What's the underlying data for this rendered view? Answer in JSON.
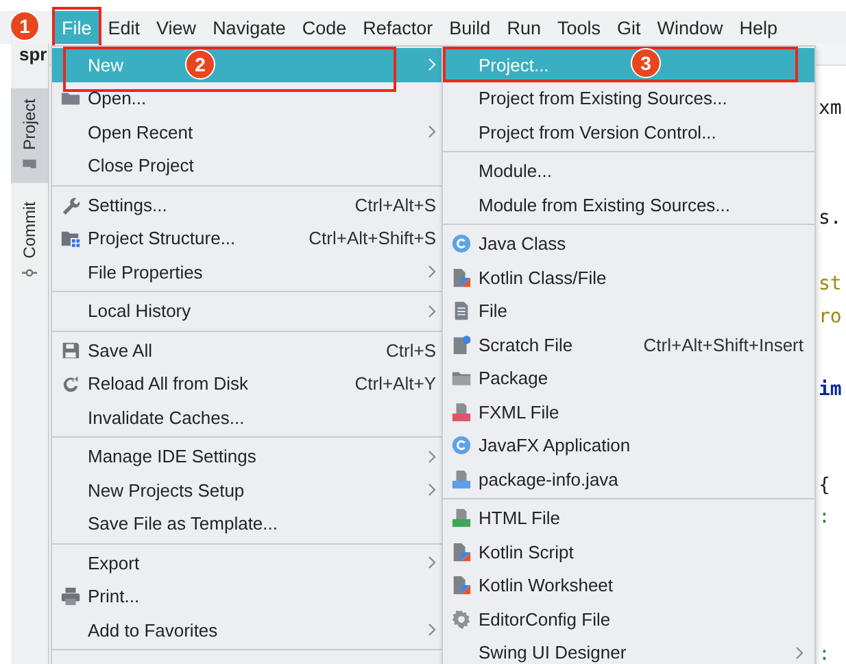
{
  "menubar": [
    {
      "label": "File",
      "selected": true,
      "callout": "1"
    },
    {
      "label": "Edit",
      "selected": false
    },
    {
      "label": "View",
      "selected": false
    },
    {
      "label": "Navigate",
      "selected": false
    },
    {
      "label": "Code",
      "selected": false
    },
    {
      "label": "Refactor",
      "selected": false
    },
    {
      "label": "Build",
      "selected": false
    },
    {
      "label": "Run",
      "selected": false
    },
    {
      "label": "Tools",
      "selected": false
    },
    {
      "label": "Git",
      "selected": false
    },
    {
      "label": "Window",
      "selected": false
    },
    {
      "label": "Help",
      "selected": false
    }
  ],
  "editor_tab": {
    "label": "spr"
  },
  "side_tabs": [
    {
      "label": "Project",
      "selected": true
    },
    {
      "label": "Commit",
      "selected": false
    }
  ],
  "code_lines": [
    {
      "text": "xm",
      "kind": "plain"
    },
    {
      "text": "s.",
      "kind": "plain"
    },
    {
      "text": "st",
      "kind": "string"
    },
    {
      "text": "ro",
      "kind": "string"
    },
    {
      "text": "im",
      "kind": "keyword"
    },
    {
      "text": "{",
      "kind": "plain"
    },
    {
      "text": ":",
      "kind": "annotation"
    },
    {
      "text": ":",
      "kind": "annotation"
    }
  ],
  "file_menu": {
    "items": [
      {
        "kind": "plain",
        "label": "New",
        "selected": true,
        "submenu": true,
        "callout": "2"
      },
      {
        "kind": "folder",
        "label": "Open...",
        "selected": false,
        "submenu": false
      },
      {
        "kind": "plain",
        "label": "Open Recent",
        "selected": false,
        "submenu": true
      },
      {
        "kind": "plain",
        "label": "Close Project",
        "selected": false,
        "submenu": false
      },
      {
        "kind": "separator"
      },
      {
        "kind": "wrench",
        "label": "Settings...",
        "shortcut": "Ctrl+Alt+S",
        "selected": false,
        "submenu": false
      },
      {
        "kind": "structure",
        "label": "Project Structure...",
        "shortcut": "Ctrl+Alt+Shift+S",
        "selected": false,
        "submenu": false
      },
      {
        "kind": "plain",
        "label": "File Properties",
        "selected": false,
        "submenu": true
      },
      {
        "kind": "separator"
      },
      {
        "kind": "plain",
        "label": "Local History",
        "selected": false,
        "submenu": true
      },
      {
        "kind": "separator"
      },
      {
        "kind": "floppy",
        "label": "Save All",
        "shortcut": "Ctrl+S",
        "selected": false,
        "submenu": false
      },
      {
        "kind": "reload",
        "label": "Reload All from Disk",
        "shortcut": "Ctrl+Alt+Y",
        "selected": false,
        "submenu": false
      },
      {
        "kind": "plain",
        "label": "Invalidate Caches...",
        "selected": false,
        "submenu": false
      },
      {
        "kind": "separator"
      },
      {
        "kind": "plain",
        "label": "Manage IDE Settings",
        "selected": false,
        "submenu": true
      },
      {
        "kind": "plain",
        "label": "New Projects Setup",
        "selected": false,
        "submenu": true
      },
      {
        "kind": "plain",
        "label": "Save File as Template...",
        "selected": false,
        "submenu": false
      },
      {
        "kind": "separator"
      },
      {
        "kind": "plain",
        "label": "Export",
        "selected": false,
        "submenu": true
      },
      {
        "kind": "printer",
        "label": "Print...",
        "selected": false,
        "submenu": false
      },
      {
        "kind": "plain",
        "label": "Add to Favorites",
        "selected": false,
        "submenu": true
      },
      {
        "kind": "separator"
      }
    ]
  },
  "new_submenu": {
    "items": [
      {
        "kind": "plain",
        "label": "Project...",
        "selected": true,
        "submenu": false,
        "callout": "3"
      },
      {
        "kind": "plain",
        "label": "Project from Existing Sources...",
        "selected": false,
        "submenu": false
      },
      {
        "kind": "plain",
        "label": "Project from Version Control...",
        "selected": false,
        "submenu": false
      },
      {
        "kind": "separator"
      },
      {
        "kind": "plain",
        "label": "Module...",
        "selected": false,
        "submenu": false
      },
      {
        "kind": "plain",
        "label": "Module from Existing Sources...",
        "selected": false,
        "submenu": false
      },
      {
        "kind": "separator"
      },
      {
        "kind": "class",
        "label": "Java Class",
        "selected": false,
        "submenu": false
      },
      {
        "kind": "kotlin",
        "label": "Kotlin Class/File",
        "selected": false,
        "submenu": false
      },
      {
        "kind": "file",
        "label": "File",
        "selected": false,
        "submenu": false
      },
      {
        "kind": "scratch",
        "label": "Scratch File",
        "shortcut": "Ctrl+Alt+Shift+Insert",
        "selected": false,
        "submenu": false
      },
      {
        "kind": "package",
        "label": "Package",
        "selected": false,
        "submenu": false
      },
      {
        "kind": "fxml",
        "label": "FXML File",
        "selected": false,
        "submenu": false
      },
      {
        "kind": "class",
        "label": "JavaFX Application",
        "selected": false,
        "submenu": false
      },
      {
        "kind": "javafile",
        "label": "package-info.java",
        "selected": false,
        "submenu": false
      },
      {
        "kind": "separator"
      },
      {
        "kind": "html",
        "label": "HTML File",
        "selected": false,
        "submenu": false
      },
      {
        "kind": "kotlin",
        "label": "Kotlin Script",
        "selected": false,
        "submenu": false
      },
      {
        "kind": "kotlin",
        "label": "Kotlin Worksheet",
        "selected": false,
        "submenu": false
      },
      {
        "kind": "gear",
        "label": "EditorConfig File",
        "selected": false,
        "submenu": false
      },
      {
        "kind": "plain",
        "label": "Swing UI Designer",
        "selected": false,
        "submenu": true
      }
    ]
  }
}
